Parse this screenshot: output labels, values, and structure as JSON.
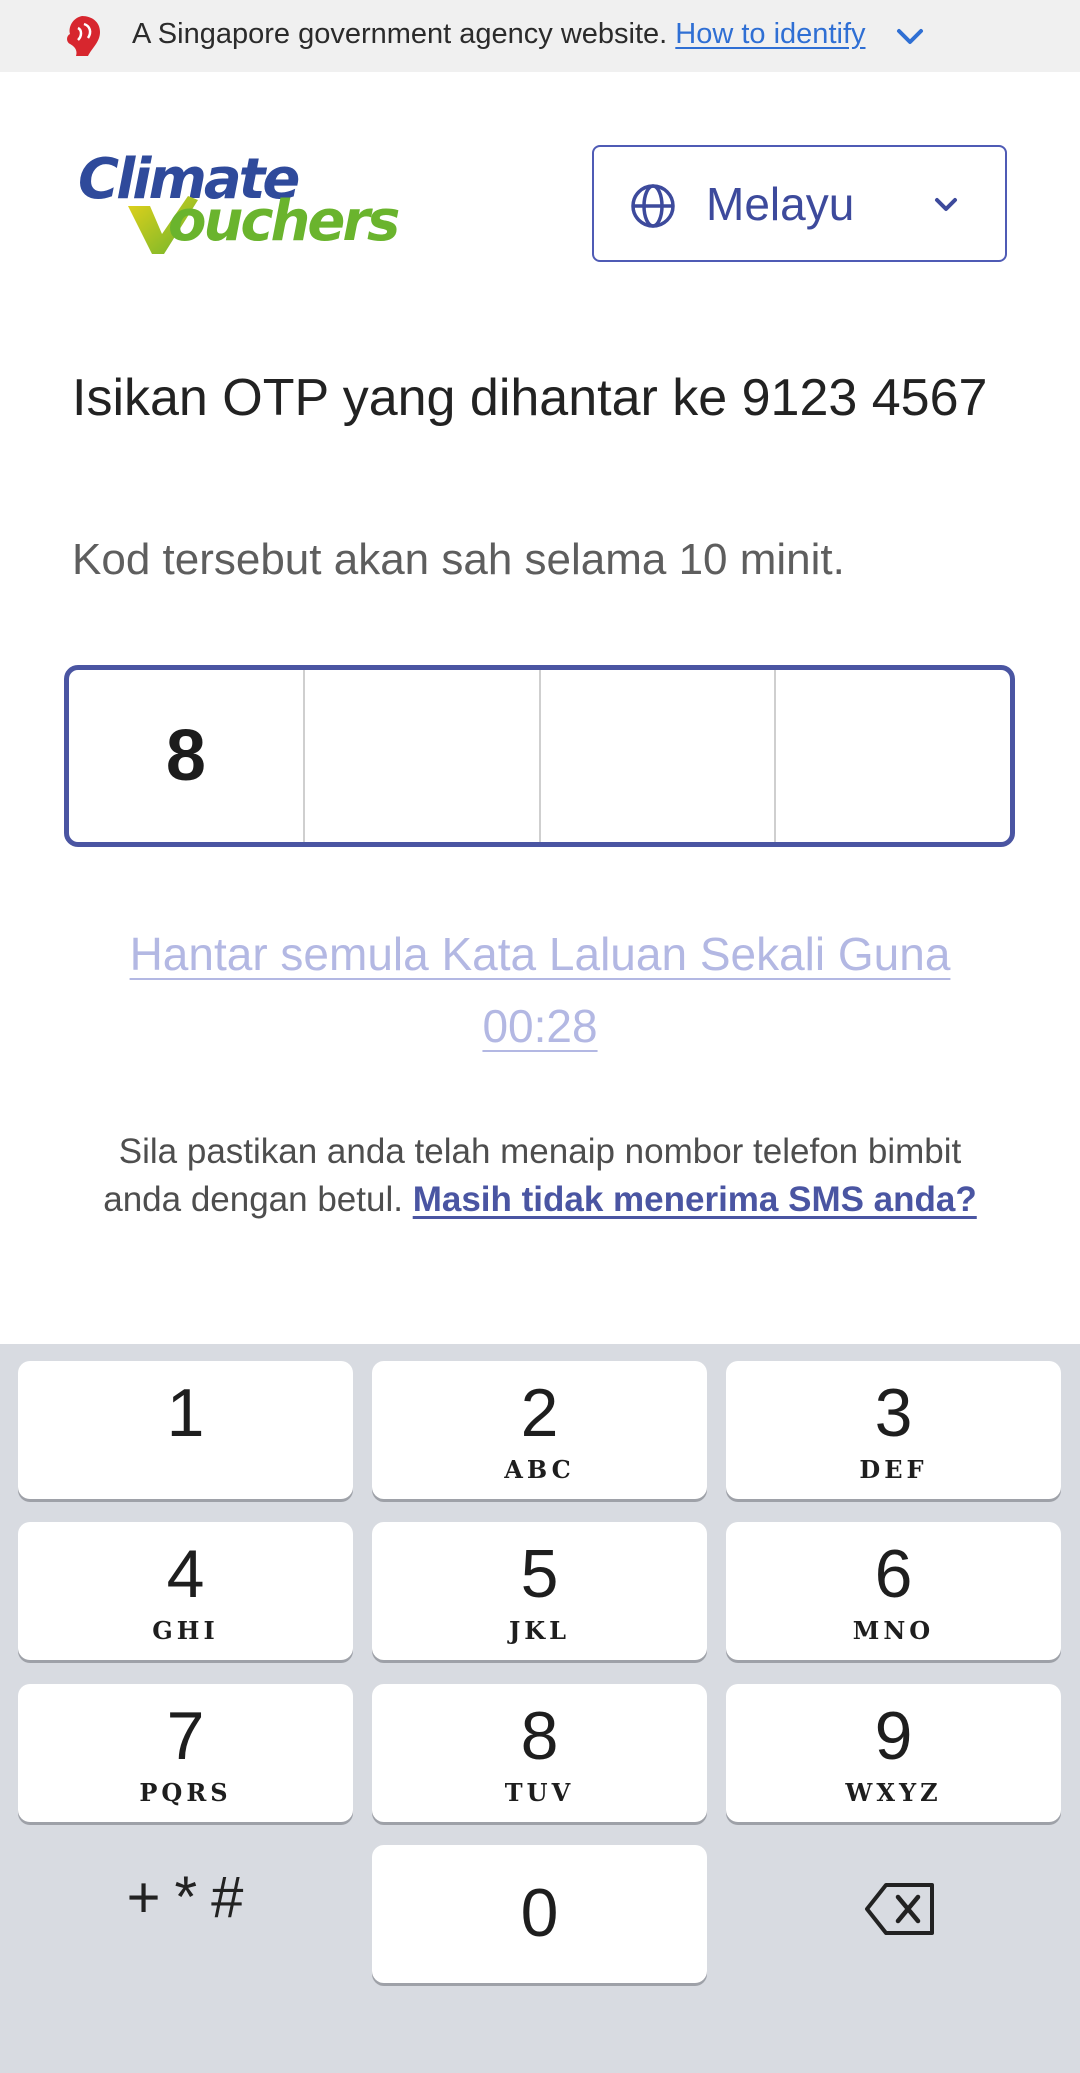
{
  "gov_banner": {
    "text": "A Singapore government agency website.",
    "link": "How to identify",
    "icons": [
      "merlion-icon",
      "chevron-down-icon"
    ]
  },
  "header": {
    "logo_line1": "Climate",
    "logo_line2": "ouchers",
    "language": "Melayu",
    "icons": [
      "globe-icon",
      "chevron-down-icon"
    ]
  },
  "otp": {
    "title": "Isikan OTP yang dihantar ke 9123 4567",
    "subtitle": "Kod tersebut akan sah selama 10 minit.",
    "digits": [
      "8",
      "",
      "",
      ""
    ],
    "resend": "Hantar semula Kata Laluan Sekali Guna 00:28",
    "help_text": "Sila pastikan anda telah menaip nombor telefon bimbit anda dengan betul.",
    "help_link": "Masih tidak menerima SMS anda?"
  },
  "colors": {
    "brand_blue": "#4a55a2",
    "link_blue": "#2f6fd4",
    "logo_green": "#6ab42d",
    "resend_disabled": "#b3b8e3",
    "keyboard_bg": "#d8dbe1"
  },
  "keyboard": {
    "keys": [
      {
        "num": "1",
        "letters": ""
      },
      {
        "num": "2",
        "letters": "ABC"
      },
      {
        "num": "3",
        "letters": "DEF"
      },
      {
        "num": "4",
        "letters": "GHI"
      },
      {
        "num": "5",
        "letters": "JKL"
      },
      {
        "num": "6",
        "letters": "MNO"
      },
      {
        "num": "7",
        "letters": "PQRS"
      },
      {
        "num": "8",
        "letters": "TUV"
      },
      {
        "num": "9",
        "letters": "WXYZ"
      },
      {
        "num": "0",
        "letters": ""
      }
    ],
    "symbols": "+*#",
    "backspace_icon": "backspace-icon"
  }
}
